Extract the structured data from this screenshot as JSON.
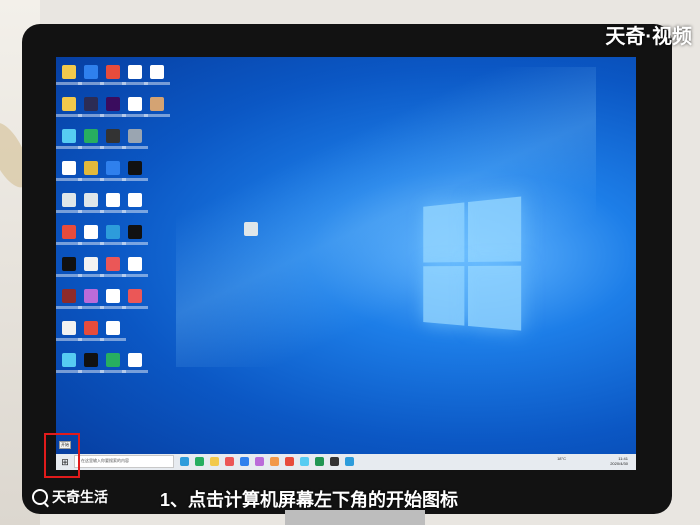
{
  "watermark": "天奇·视频",
  "brand": {
    "name": "天奇生活",
    "icon": "magnifier-logo-icon"
  },
  "caption": "1、点击计算机屏幕左下角的开始图标",
  "tooltip": "开始",
  "taskbar": {
    "start_icon": "windows-start-icon",
    "search_placeholder": "在这里输入你要搜索的内容",
    "tray_text": "18°C",
    "clock_time": "11:41",
    "clock_date": "2020/4/30"
  },
  "desktop_icons": [
    {
      "name": "desktop-icon",
      "color": "#f2c94c"
    },
    {
      "name": "desktop-icon",
      "color": "#2f80ed"
    },
    {
      "name": "desktop-icon",
      "color": "#e74c3c"
    },
    {
      "name": "desktop-icon",
      "color": "#ffffff"
    },
    {
      "name": "desktop-icon",
      "color": "#ffffff"
    },
    {
      "name": "desktop-icon",
      "color": "#f2c94c"
    },
    {
      "name": "desktop-icon",
      "color": "#2c2c54"
    },
    {
      "name": "desktop-icon",
      "color": "#3a0c5e"
    },
    {
      "name": "desktop-icon",
      "color": "#ffffff"
    },
    {
      "name": "desktop-icon",
      "color": "#d4a373"
    },
    {
      "name": "desktop-icon",
      "color": "#56ccf2"
    },
    {
      "name": "desktop-icon",
      "color": "#27ae60"
    },
    {
      "name": "desktop-icon",
      "color": "#333333"
    },
    {
      "name": "desktop-icon",
      "color": "#9aa5b1"
    },
    {
      "name": "desktop-icon",
      "color": "#ffffff"
    },
    {
      "name": "desktop-icon",
      "color": "#e2b93b"
    },
    {
      "name": "desktop-icon",
      "color": "#2f80ed"
    },
    {
      "name": "desktop-icon",
      "color": "#111111"
    },
    {
      "name": "desktop-icon",
      "color": "#dfe6e9"
    },
    {
      "name": "desktop-icon",
      "color": "#dfe6e9"
    },
    {
      "name": "desktop-icon",
      "color": "#ffffff"
    },
    {
      "name": "desktop-icon",
      "color": "#ffffff"
    },
    {
      "name": "desktop-icon",
      "color": "#e74c3c"
    },
    {
      "name": "desktop-icon",
      "color": "#ffffff"
    },
    {
      "name": "desktop-icon",
      "color": "#2d9cdb"
    },
    {
      "name": "desktop-icon",
      "color": "#111111"
    },
    {
      "name": "desktop-icon",
      "color": "#111111"
    },
    {
      "name": "desktop-icon",
      "color": "#f2f2f2"
    },
    {
      "name": "desktop-icon",
      "color": "#eb5757"
    },
    {
      "name": "desktop-icon",
      "color": "#ffffff"
    },
    {
      "name": "desktop-icon",
      "color": "#8e2b2b"
    },
    {
      "name": "desktop-icon",
      "color": "#bb6bd9"
    },
    {
      "name": "desktop-icon",
      "color": "#ffffff"
    },
    {
      "name": "desktop-icon",
      "color": "#eb5757"
    },
    {
      "name": "desktop-icon",
      "color": "#f2f2f2"
    },
    {
      "name": "desktop-icon",
      "color": "#e74c3c"
    },
    {
      "name": "desktop-icon",
      "color": "#ffffff"
    },
    {
      "name": "desktop-icon",
      "color": "#56ccf2"
    },
    {
      "name": "desktop-icon",
      "color": "#111111"
    },
    {
      "name": "desktop-icon",
      "color": "#27ae60"
    },
    {
      "name": "desktop-icon",
      "color": "#ffffff"
    }
  ],
  "taskbar_apps": [
    "#2d9cdb",
    "#27ae60",
    "#f2c94c",
    "#eb5757",
    "#2f80ed",
    "#bb6bd9",
    "#f2994a",
    "#e74c3c",
    "#56ccf2",
    "#219653",
    "#333333",
    "#2d9cdb"
  ]
}
